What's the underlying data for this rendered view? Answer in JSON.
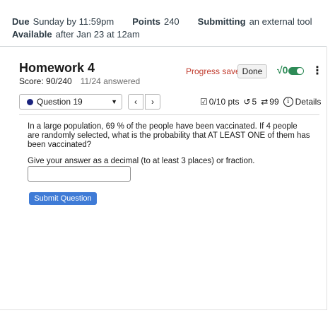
{
  "assignment": {
    "due_label": "Due",
    "due_value": "Sunday by 11:59pm",
    "points_label": "Points",
    "points_value": "240",
    "submitting_label": "Submitting",
    "submitting_value": "an external tool",
    "available_label": "Available",
    "available_value": "after Jan 23 at 12am"
  },
  "homework": {
    "title": "Homework 4",
    "score": "Score: 90/240",
    "answered": "11/24 answered",
    "progress_saved": "Progress saved",
    "done_label": "Done",
    "math_toggle_label": "√0",
    "math_toggle_on": true
  },
  "question_nav": {
    "selected_question": "Question 19",
    "prev_label": "‹",
    "next_label": "›",
    "points": "0/10 pts",
    "retries": "5",
    "attempts": "99",
    "details_label": "Details"
  },
  "question": {
    "text": "In a large population, 69 % of the people have been vaccinated. If 4 people are randomly selected, what is the probability that AT LEAST ONE of them has been vaccinated?",
    "prompt": "Give your answer as a decimal (to at least 3 places) or fraction.",
    "answer_value": "",
    "submit_label": "Submit Question"
  },
  "colors": {
    "accent_blue": "#3f7bd6",
    "progress_red": "#c0392b",
    "toggle_green": "#2e8b57",
    "question_dot": "#1a237e"
  }
}
